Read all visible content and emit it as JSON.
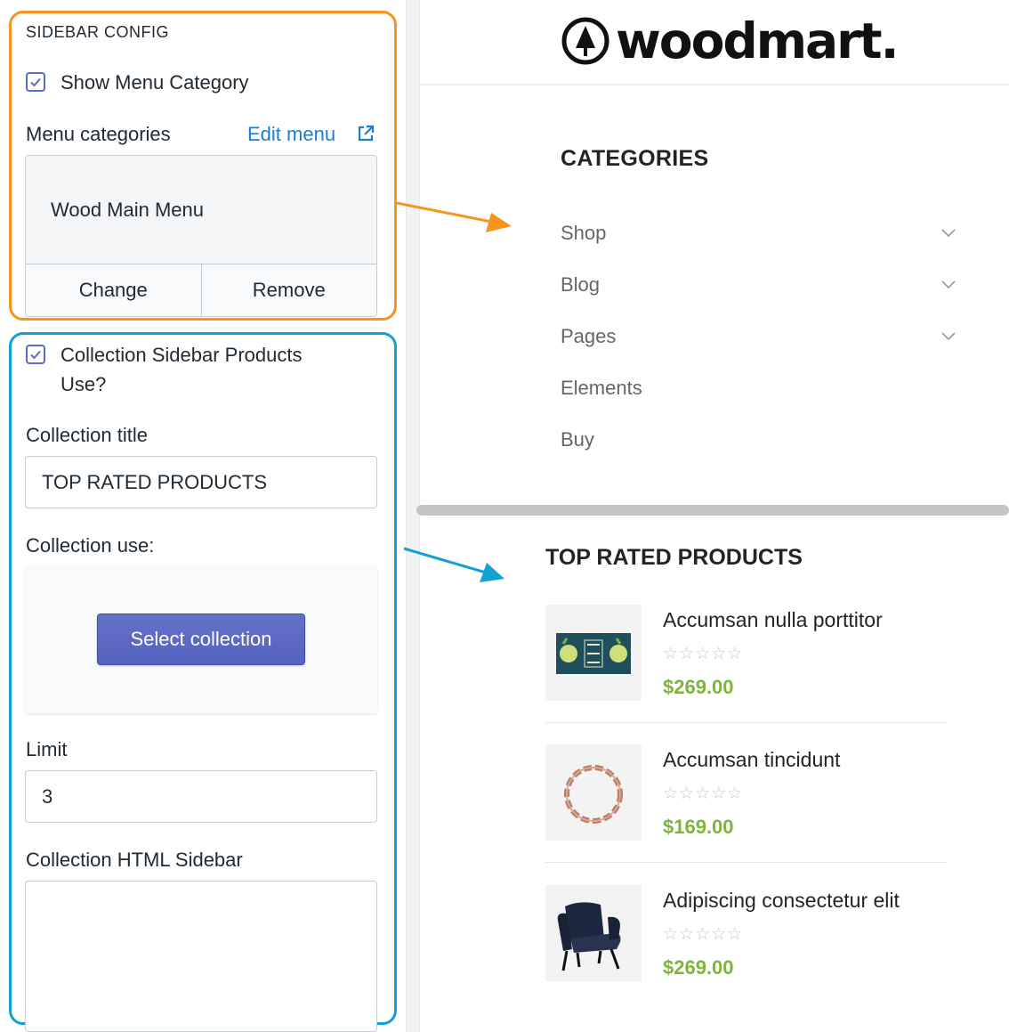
{
  "settings": {
    "sidebar_config_heading": "SIDEBAR CONFIG",
    "show_menu_category_label": "Show Menu Category",
    "show_menu_category_checked": true,
    "menu_categories_label": "Menu categories",
    "edit_menu_link": "Edit menu",
    "selected_menu": "Wood Main Menu",
    "change_button": "Change",
    "remove_button": "Remove",
    "collection_sidebar_use_label_line1": "Collection Sidebar Products",
    "collection_sidebar_use_label_line2": "Use?",
    "collection_sidebar_use_checked": true,
    "collection_title_label": "Collection title",
    "collection_title_value": "TOP RATED PRODUCTS",
    "collection_use_label": "Collection use:",
    "select_collection_button": "Select collection",
    "limit_label": "Limit",
    "limit_value": "3",
    "collection_html_sidebar_label": "Collection HTML Sidebar"
  },
  "preview": {
    "logo_text": "woodmart.",
    "categories_title": "CATEGORIES",
    "categories": [
      {
        "label": "Shop",
        "has_submenu": true
      },
      {
        "label": "Blog",
        "has_submenu": true
      },
      {
        "label": "Pages",
        "has_submenu": true
      },
      {
        "label": "Elements",
        "has_submenu": false
      },
      {
        "label": "Buy",
        "has_submenu": false
      }
    ],
    "top_rated_title": "TOP RATED PRODUCTS",
    "products": [
      {
        "name": "Accumsan nulla porttitor",
        "rating": 0,
        "price": "$269.00",
        "thumb": "bergamot-box"
      },
      {
        "name": "Accumsan tincidunt",
        "rating": 0,
        "price": "$169.00",
        "thumb": "bracelet"
      },
      {
        "name": "Adipiscing consectetur elit",
        "rating": 0,
        "price": "$269.00",
        "thumb": "armchair"
      }
    ]
  },
  "colors": {
    "orange_highlight": "#f7941d",
    "blue_highlight": "#14a0d2",
    "price_green": "#7db43c",
    "primary_button": "#5c6ac4",
    "link_blue": "#1b7ed6"
  }
}
